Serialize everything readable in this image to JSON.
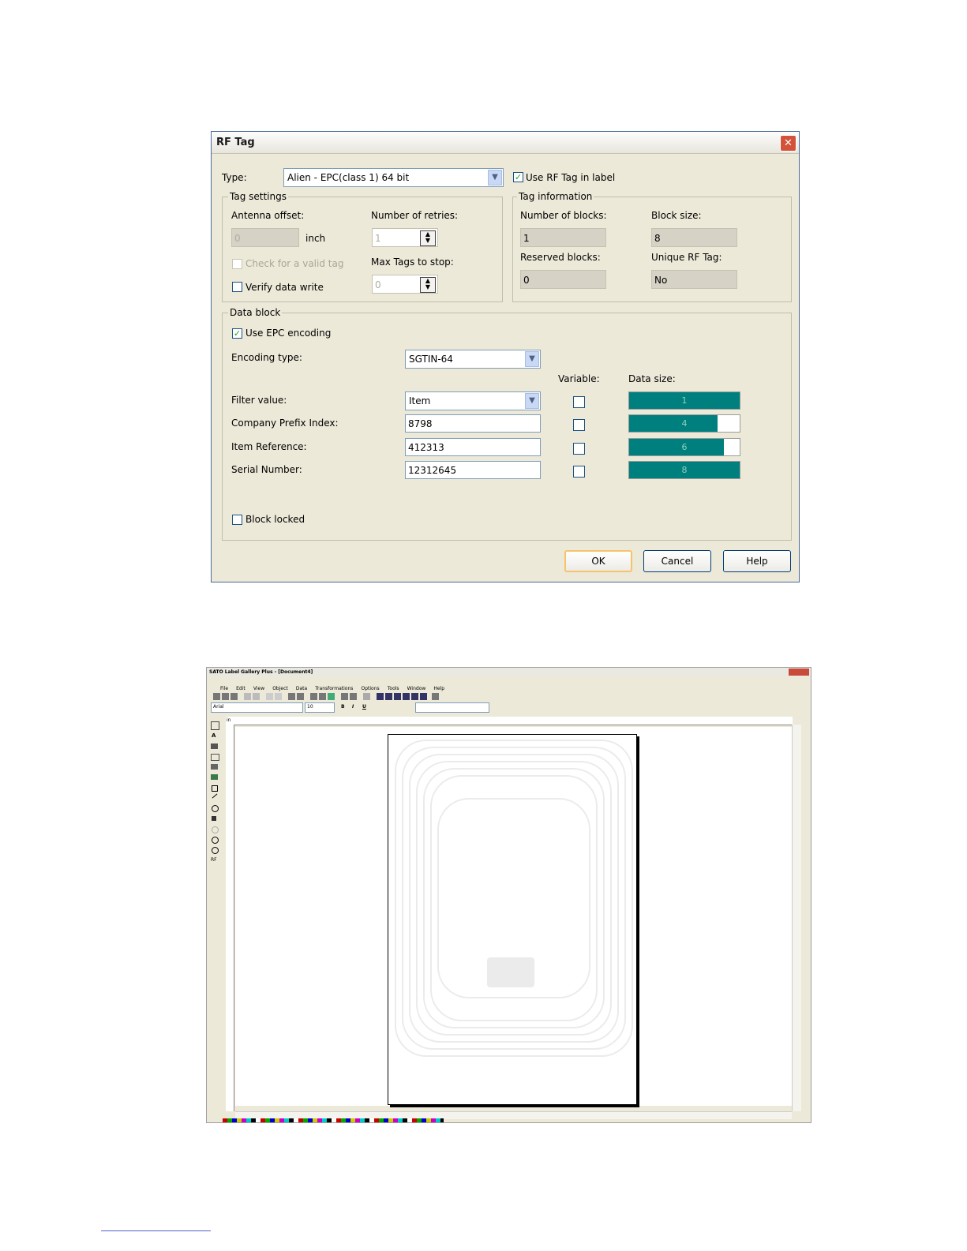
{
  "dialog": {
    "title": "RF Tag",
    "type_label": "Type:",
    "type_value": "Alien - EPC(class 1) 64 bit",
    "use_rf_tag_label": "Use RF Tag in label",
    "use_rf_tag_checked": true,
    "tag_settings": {
      "title": "Tag settings",
      "antenna_offset_label": "Antenna offset:",
      "antenna_offset_value": "0",
      "antenna_offset_unit": "inch",
      "retries_label": "Number of retries:",
      "retries_value": "1",
      "check_valid_label": "Check for a valid tag",
      "max_tags_label": "Max Tags to stop:",
      "max_tags_value": "0",
      "verify_label": "Verify data write"
    },
    "tag_info": {
      "title": "Tag information",
      "blocks_label": "Number of blocks:",
      "blocks_value": "1",
      "block_size_label": "Block size:",
      "block_size_value": "8",
      "reserved_label": "Reserved blocks:",
      "reserved_value": "0",
      "unique_label": "Unique RF Tag:",
      "unique_value": "No"
    },
    "data_block": {
      "title": "Data block",
      "use_epc_label": "Use EPC encoding",
      "use_epc_checked": true,
      "encoding_label": "Encoding type:",
      "encoding_value": "SGTIN-64",
      "variable_header": "Variable:",
      "data_size_header": "Data size:",
      "rows": [
        {
          "label": "Filter value:",
          "value": "Item",
          "size": "1",
          "fill": 1.0
        },
        {
          "label": "Company Prefix Index:",
          "value": "8798",
          "size": "4",
          "fill": 0.8
        },
        {
          "label": "Item Reference:",
          "value": "412313",
          "size": "6",
          "fill": 0.86
        },
        {
          "label": "Serial Number:",
          "value": "12312645",
          "size": "8",
          "fill": 1.0
        }
      ],
      "block_locked_label": "Block locked"
    },
    "buttons": {
      "ok": "OK",
      "cancel": "Cancel",
      "help": "Help"
    }
  },
  "app": {
    "title": "SATO Label Gallery Plus - [Document4]",
    "menu": [
      "File",
      "Edit",
      "View",
      "Object",
      "Data",
      "Transformations",
      "Options",
      "Tools",
      "Window",
      "Help"
    ],
    "font_name": "Arial",
    "font_size": "10",
    "format_buttons": [
      "B",
      "I",
      "U"
    ],
    "toolbox_rf": "RF",
    "ruler_unit": "in"
  }
}
